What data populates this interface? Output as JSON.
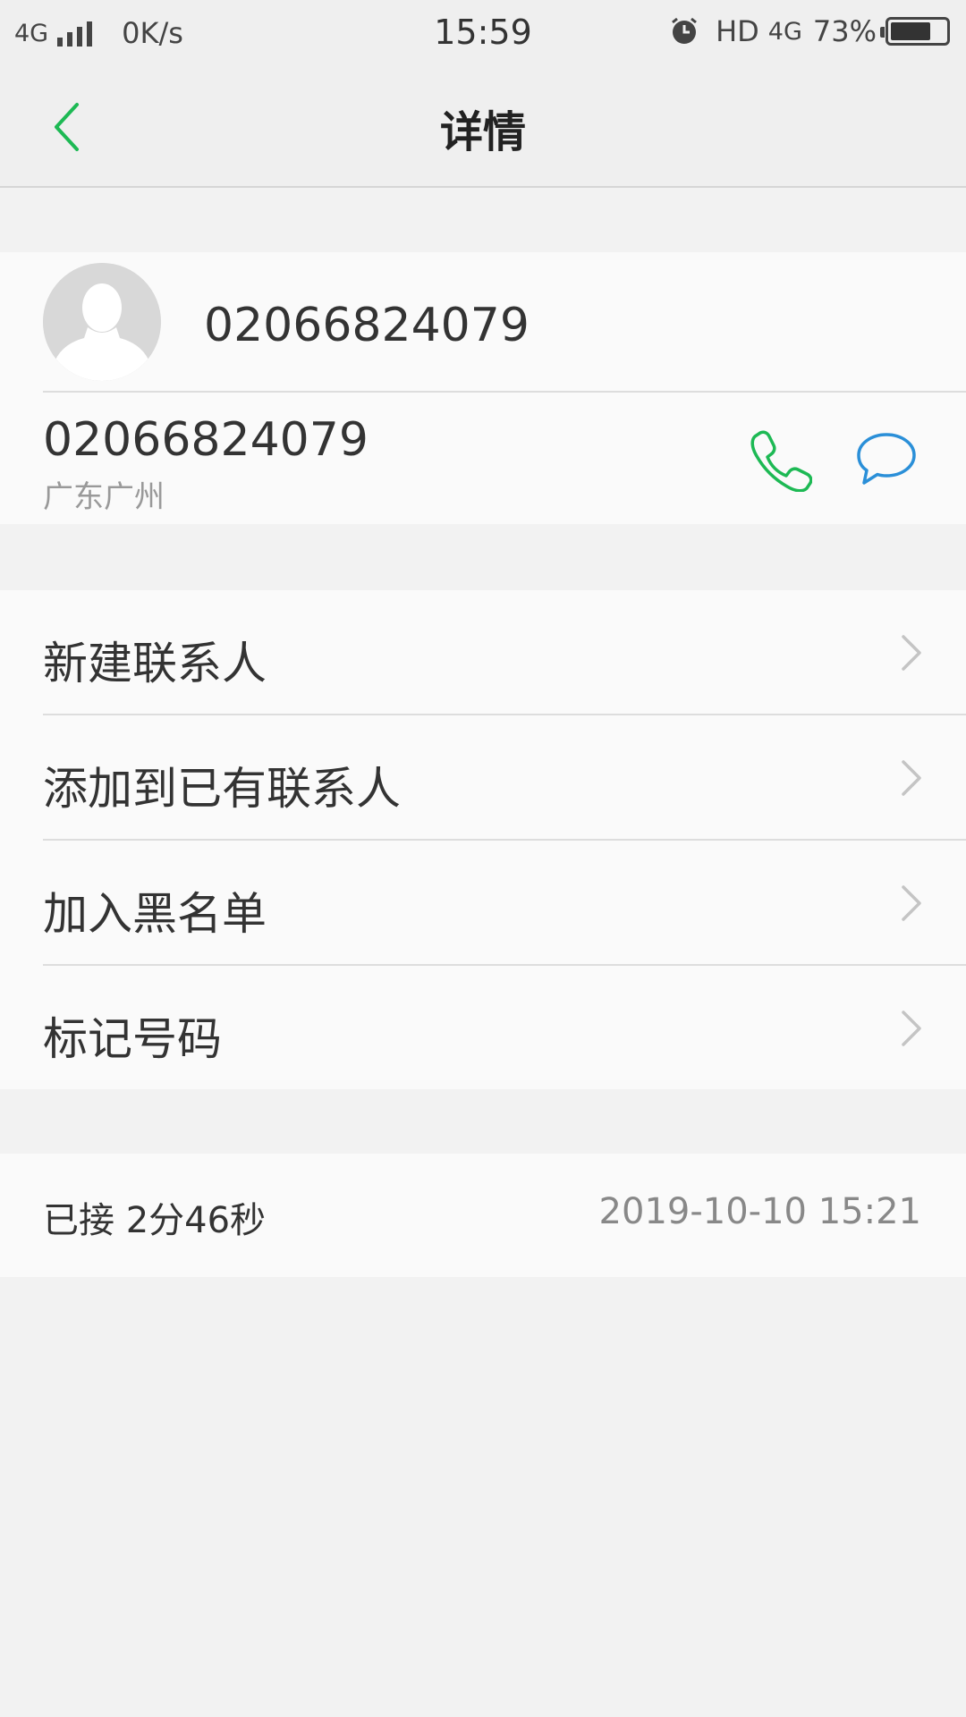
{
  "status_bar": {
    "network_left": "4G",
    "speed": "0K/s",
    "time": "15:59",
    "hd": "HD",
    "network_right": "4G",
    "battery": "73%",
    "battery_level": 0.73
  },
  "header": {
    "title": "详情",
    "back_icon": "back-chevron-icon"
  },
  "contact": {
    "name": "02066824079",
    "number": "02066824079",
    "location": "广东广州",
    "call_icon": "phone-icon",
    "message_icon": "message-bubble-icon"
  },
  "menu": {
    "items": [
      {
        "label": "新建联系人"
      },
      {
        "label": "添加到已有联系人"
      },
      {
        "label": "加入黑名单"
      },
      {
        "label": "标记号码"
      }
    ]
  },
  "call_log": {
    "status": "已接 2分46秒",
    "datetime": "2019-10-10 15:21"
  },
  "colors": {
    "accent_green": "#1db954",
    "message_blue": "#2a8fd8"
  }
}
